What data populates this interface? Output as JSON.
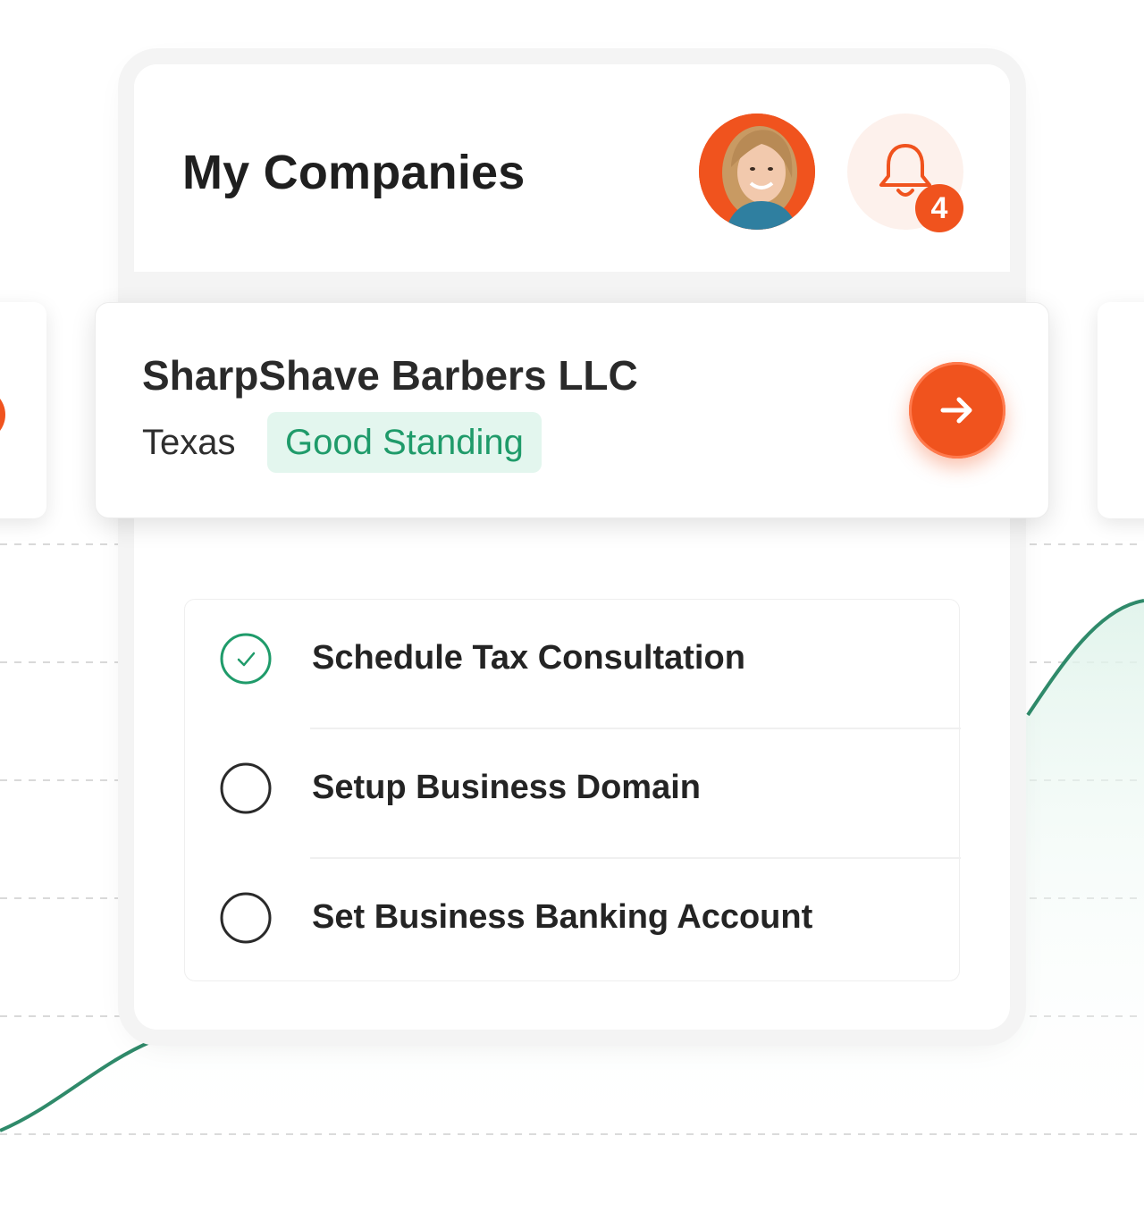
{
  "header": {
    "title": "My Companies",
    "notification_count": "4"
  },
  "company": {
    "name": "SharpShave Barbers LLC",
    "state": "Texas",
    "status": "Good Standing"
  },
  "tasks": [
    {
      "label": "Schedule Tax Consultation",
      "completed": true
    },
    {
      "label": "Setup Business Domain",
      "completed": false
    },
    {
      "label": "Set Business Banking Account",
      "completed": false
    }
  ],
  "colors": {
    "accent": "#f0531e",
    "success": "#1f9b6a",
    "success_bg": "#e3f6ee",
    "chart_line": "#2f8a6a"
  },
  "icons": {
    "bell": "bell-icon",
    "arrow": "arrow-right-icon",
    "check": "check-circle-icon",
    "empty": "empty-circle-icon"
  }
}
